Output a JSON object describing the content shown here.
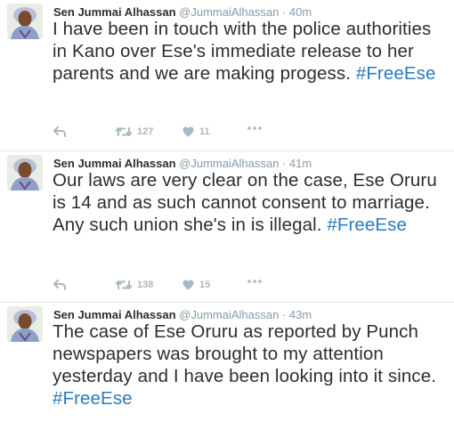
{
  "tweets": [
    {
      "name": "Sen Jummai Alhassan",
      "handle": "@JummaiAlhassan",
      "separator": "·",
      "time": "40m",
      "text": "I have been in touch with the police authorities in Kano over Ese's immediate release to her parents and we are making progess.",
      "hashtag": "#FreeEse",
      "retweets": "127",
      "likes": "11"
    },
    {
      "name": "Sen Jummai Alhassan",
      "handle": "@JummaiAlhassan",
      "separator": "·",
      "time": "41m",
      "text": "Our laws are very clear on the case, Ese Oruru is 14 and as such cannot consent to marriage. Any such union she's in is illegal.",
      "hashtag": "#FreeEse",
      "retweets": "138",
      "likes": "15"
    },
    {
      "name": "Sen Jummai Alhassan",
      "handle": "@JummaiAlhassan",
      "separator": "·",
      "time": "43m",
      "text": "The case of Ese Oruru as reported by Punch newspapers was brought to my attention yesterday and I have been looking into it since.",
      "hashtag": "#FreeEse"
    }
  ],
  "icons": {
    "reply": "reply-icon",
    "retweet": "retweet-icon",
    "like": "heart-icon",
    "more": "more-icon"
  },
  "colors": {
    "text": "#292f33",
    "muted": "#8899a6",
    "hashtag": "#2b7bb9",
    "action": "#aab8c2",
    "divider": "#e1e8ed"
  }
}
